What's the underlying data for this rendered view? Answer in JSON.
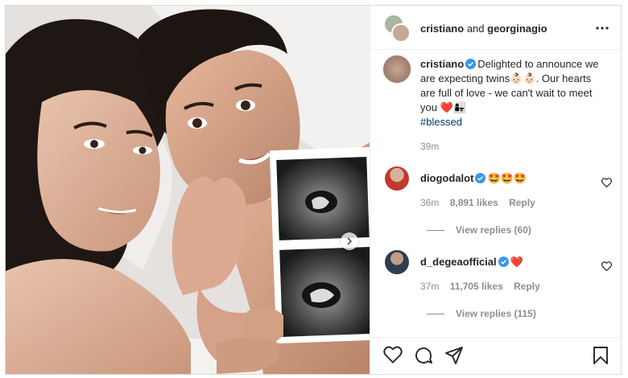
{
  "header": {
    "user1": "cristiano",
    "joiner": "and",
    "user2": "georginagio",
    "more_icon": "more-horizontal-icon"
  },
  "caption": {
    "username": "cristiano",
    "line1": "Delighted to announce we",
    "line2": "are expecting twins👶🏻👶🏻. Our hearts",
    "line3": "are full of love - we can't wait to meet",
    "line4": "you ❤️👩‍👧",
    "hashtag": "#blessed",
    "time": "39m"
  },
  "comments": [
    {
      "username": "diogodalot",
      "text": "🤩🤩🤩",
      "time": "36m",
      "likes": "8,891 likes",
      "reply": "Reply",
      "view_replies": "View replies (60)"
    },
    {
      "username": "d_degeaofficial",
      "text": "❤️",
      "time": "37m",
      "likes": "11,705 likes",
      "reply": "Reply",
      "view_replies": "View replies (115)"
    }
  ],
  "colors": {
    "verified": "#3897f0",
    "border": "#dbdbdb",
    "muted": "#8e8e8e",
    "link": "#00376b"
  },
  "icons": [
    "heart-icon",
    "comment-icon",
    "share-icon",
    "bookmark-icon",
    "chevron-right-icon",
    "verified-icon"
  ]
}
